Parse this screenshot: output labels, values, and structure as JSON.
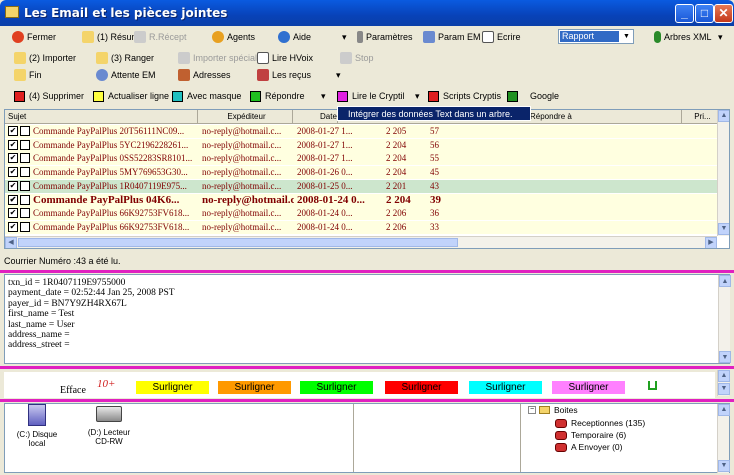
{
  "window": {
    "title": "Les Email et les pièces jointes",
    "minimize": "_",
    "maximize": "□",
    "close": "✕"
  },
  "toolbar1": {
    "fermer": "Fermer",
    "resume": "(1) Résumé",
    "recept": "R.Récept",
    "agents": "Agents",
    "aide": "Aide",
    "parametres": "Paramètres",
    "param_em": "Param EM",
    "ecrire": "Ecrire",
    "rapport": "Rapport",
    "arbres_xml": "Arbres XML"
  },
  "toolbar2": {
    "importer": "(2) Importer",
    "ranger": "(3) Ranger",
    "importer_special": "Importer spécial",
    "lire_hvoix": "Lire HVoix",
    "stop": "Stop"
  },
  "toolbar3": {
    "fin": "Fin",
    "attente_em": "Attente EM",
    "adresses": "Adresses",
    "les_recus": "Les reçus"
  },
  "toolbar4": {
    "supprimer": "(4) Supprimer",
    "actualiser": "Actualiser ligne",
    "avec_masque": "Avec masque",
    "repondre": "Répondre",
    "lire_cryptil": "Lire le Cryptil",
    "scripts": "Scripts Cryptis",
    "google": "Google"
  },
  "tooltip": "Intégrer des données Text dans un arbre.",
  "grid": {
    "headers": [
      "Sujet",
      "Expéditeur",
      "Date",
      "Répondre à",
      "Pri..."
    ],
    "rows": [
      {
        "subject": "Commande PayPalPlus 20T56111NC09...",
        "sender": "no-reply@hotmail.c...",
        "date": "2008-01-27 1...",
        "size": "2 205",
        "n": "57"
      },
      {
        "subject": "Commande PayPalPlus 5YC2196228261...",
        "sender": "no-reply@hotmail.c...",
        "date": "2008-01-27 1...",
        "size": "2 204",
        "n": "56"
      },
      {
        "subject": "Commande PayPalPlus 0SS52283SR8101...",
        "sender": "no-reply@hotmail.c...",
        "date": "2008-01-27 1...",
        "size": "2 204",
        "n": "55"
      },
      {
        "subject": "Commande PayPalPlus 5MY769653G30...",
        "sender": "no-reply@hotmail.c...",
        "date": "2008-01-26 0...",
        "size": "2 204",
        "n": "45"
      },
      {
        "subject": "Commande PayPalPlus 1R0407119E975...",
        "sender": "no-reply@hotmail.c...",
        "date": "2008-01-25 0...",
        "size": "2 201",
        "n": "43"
      },
      {
        "subject": "Commande PayPalPlus 04K6...",
        "sender": "no-reply@hotmail.c...",
        "date": "2008-01-24 0...",
        "size": "2 204",
        "n": "39"
      },
      {
        "subject": "Commande PayPalPlus 66K92753FV618...",
        "sender": "no-reply@hotmail.c...",
        "date": "2008-01-24 0...",
        "size": "2 206",
        "n": "36"
      },
      {
        "subject": "Commande PayPalPlus 66K92753FV618...",
        "sender": "no-reply@hotmail.c...",
        "date": "2008-01-24 0...",
        "size": "2 206",
        "n": "33"
      }
    ]
  },
  "status": "Courrier Numéro :43 a été lu.",
  "body_lines": [
    "txn_id = 1R0407119E9755000",
    "payment_date = 02:52:44 Jan 25, 2008 PST",
    "payer_id = BN7Y9ZH4RX67L",
    "first_name = Test",
    "last_name = User",
    "address_name =",
    "address_street ="
  ],
  "highlight": {
    "efface": "Efface",
    "ten_plus": "10+",
    "buttons": [
      {
        "label": "Surligner",
        "color": "#ffff00"
      },
      {
        "label": "Surligner",
        "color": "#ff9900"
      },
      {
        "label": "Surligner",
        "color": "#00ff00"
      },
      {
        "label": "Surligner",
        "color": "#ff0000"
      },
      {
        "label": "Surligner",
        "color": "#00ffff"
      },
      {
        "label": "Surligner",
        "color": "#ff80ff"
      }
    ]
  },
  "drives": [
    {
      "label1": "(C:) Disque",
      "label2": "local",
      "icon": "hard-disk-icon"
    },
    {
      "label1": "(D:) Lecteur",
      "label2": "CD-RW",
      "icon": "cd-drive-icon"
    }
  ],
  "tree": {
    "root": "Boites",
    "children": [
      "Receptionnes (135)",
      "Temporaire (6)",
      "A Envoyer (0)"
    ]
  }
}
